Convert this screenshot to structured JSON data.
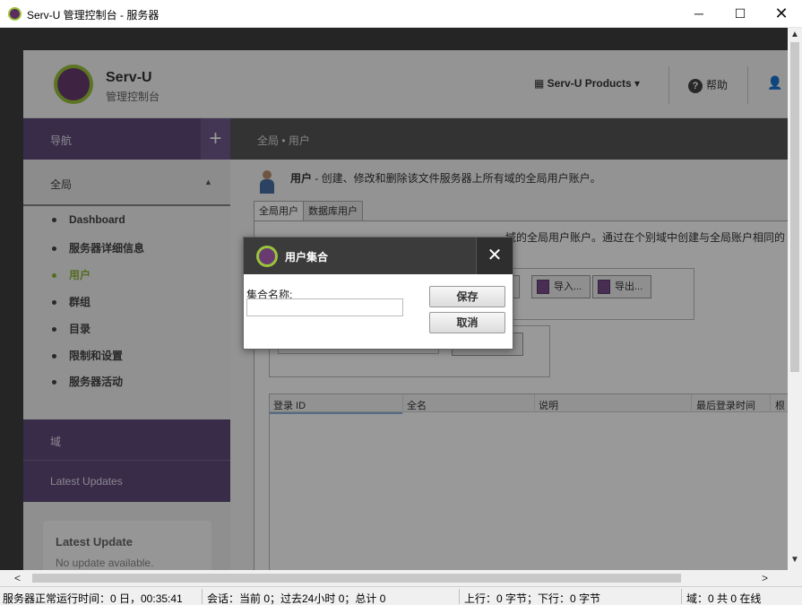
{
  "window": {
    "title": "Serv-U 管理控制台 - 服务器",
    "min_glyph": "─",
    "max_glyph": "☐",
    "close_glyph": "✕"
  },
  "header": {
    "app_name": "Serv-U",
    "app_subtitle": "管理控制台",
    "products_label": "Serv-U Products",
    "help_label": "帮助"
  },
  "sidebar": {
    "nav_label": "导航",
    "add_glyph": "+",
    "global_label": "全局",
    "items": [
      {
        "label": "Dashboard"
      },
      {
        "label": "服务器详细信息"
      },
      {
        "label": "用户"
      },
      {
        "label": "群组"
      },
      {
        "label": "目录"
      },
      {
        "label": "限制和设置"
      },
      {
        "label": "服务器活动"
      }
    ],
    "domain_label": "域",
    "updates_label": "Latest Updates",
    "update_card": {
      "title": "Latest Update",
      "text": "No update available."
    }
  },
  "main": {
    "breadcrumb": "全局 • 用户",
    "desc_title": "用户",
    "desc_text": " - 创建、修改和删除该文件服务器上所有域的全局用户账户。",
    "tabs": [
      {
        "label": "全局用户"
      },
      {
        "label": "数据库用户"
      }
    ],
    "panel_text": "域的全局用户账户。通过在个别域中创建与全局账户相同的",
    "import_label": "导入...",
    "export_label": "导出...",
    "columns": [
      "登录 ID",
      "全名",
      "说明",
      "最后登录时间",
      "根"
    ]
  },
  "dialog": {
    "title": "用户集合",
    "close_glyph": "✕",
    "field_label": "集合名称:",
    "field_value": "",
    "save_label": "保存",
    "cancel_label": "取消"
  },
  "statusbar": {
    "uptime": "服务器正常运行时间：0 日，00:35:41",
    "sessions": "会话：当前 0；过去24小时 0；总计 0",
    "transfer": "上行：0 字节；下行：0 字节",
    "domains": "域：0 共 0 在线"
  }
}
